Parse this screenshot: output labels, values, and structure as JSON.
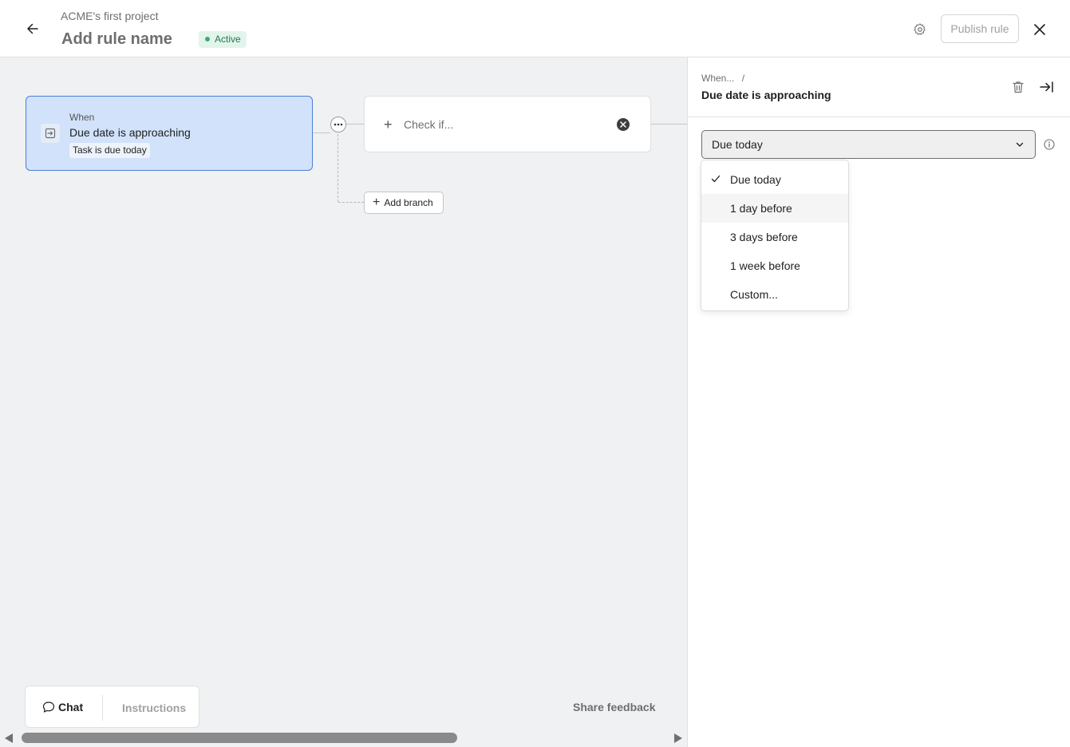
{
  "header": {
    "project_name": "ACME's first project",
    "rule_name": "Add rule name",
    "status": "Active",
    "publish_label": "Publish rule"
  },
  "canvas": {
    "trigger": {
      "label": "When",
      "title": "Due date is approaching",
      "chip": "Task is due today"
    },
    "check": {
      "label": "Check if..."
    },
    "add_branch_label": "Add branch"
  },
  "bottom": {
    "chat_label": "Chat",
    "instructions_label": "Instructions",
    "share_feedback_label": "Share feedback"
  },
  "panel": {
    "breadcrumb": "When...",
    "breadcrumb_sep": "/",
    "title": "Due date is approaching",
    "select_value": "Due today",
    "options": [
      {
        "label": "Due today",
        "selected": true
      },
      {
        "label": "1 day before",
        "selected": false
      },
      {
        "label": "3 days before",
        "selected": false
      },
      {
        "label": "1 week before",
        "selected": false
      },
      {
        "label": "Custom...",
        "selected": false
      }
    ]
  },
  "icons": {
    "back": "arrow-left-icon",
    "settings": "gear-icon",
    "close": "close-icon",
    "trigger": "calendar-arrow-icon",
    "more": "more-horizontal-icon",
    "remove": "remove-circle-icon",
    "chat": "chat-bubble-icon",
    "trash": "trash-icon",
    "collapse": "collapse-right-icon",
    "chevron": "chevron-down-icon",
    "info": "info-icon",
    "check": "checkmark-icon"
  },
  "colors": {
    "trigger_bg": "#d1e2fa",
    "trigger_border": "#4a7fd9",
    "status_bg": "#e3f4ec",
    "status_text": "#1f7a4f",
    "canvas_bg": "#f0f1f3"
  }
}
